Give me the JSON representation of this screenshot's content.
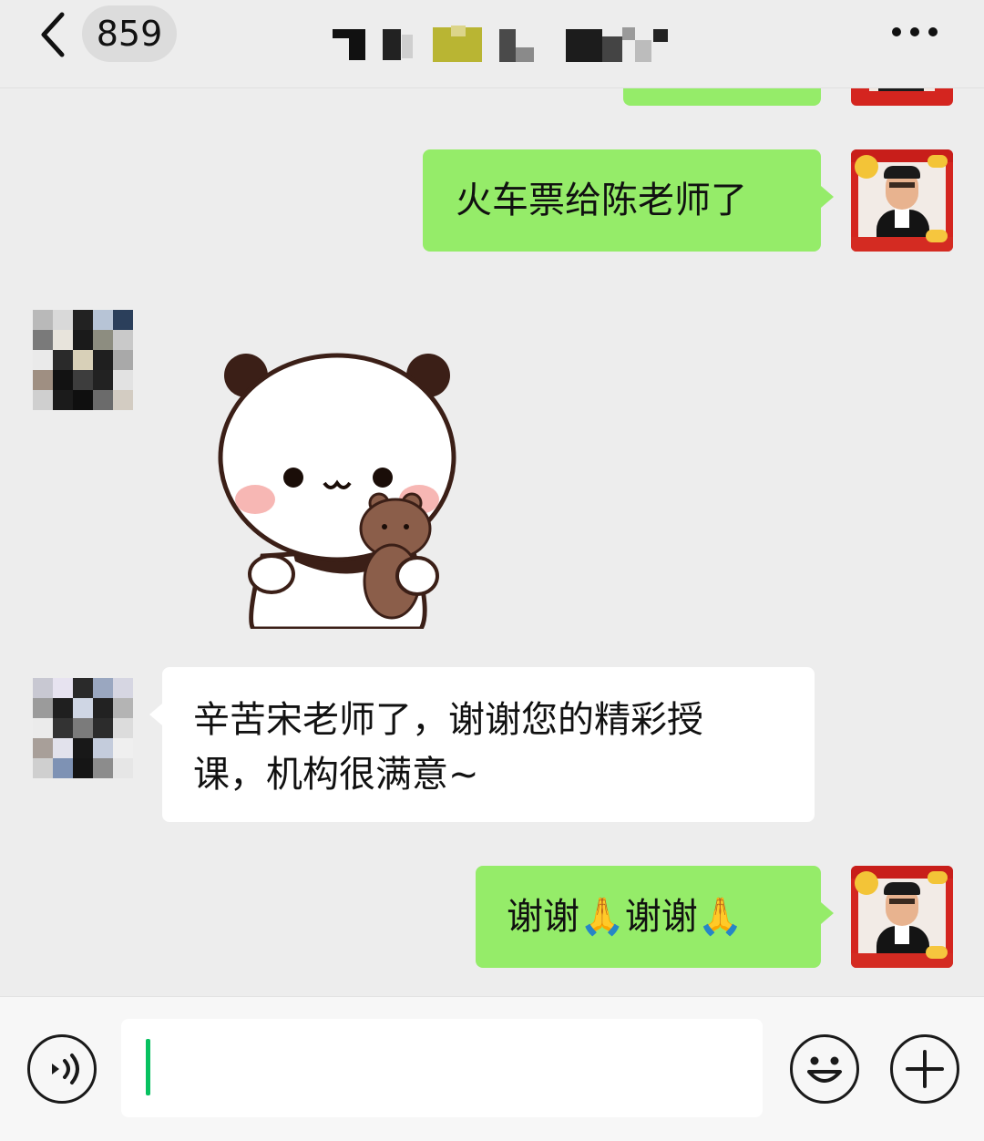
{
  "header": {
    "back_icon": "chevron-left-icon",
    "unread_count": "859",
    "more_icon": "more-dots-icon"
  },
  "messages": [
    {
      "direction": "outgoing",
      "type": "text",
      "text": "火车票给陈老师了"
    },
    {
      "direction": "incoming",
      "type": "sticker",
      "sticker": "panda-holding-teddy-bear"
    },
    {
      "direction": "incoming",
      "type": "text",
      "line1": "辛苦宋老师了，谢谢您的精彩授",
      "line2": "课，机构很满意~"
    },
    {
      "direction": "outgoing",
      "type": "text",
      "text": "谢谢🙏谢谢🙏"
    }
  ],
  "input_bar": {
    "voice_icon": "voice-icon",
    "emoji_icon": "emoji-icon",
    "plus_icon": "plus-icon",
    "input_value": ""
  },
  "colors": {
    "outgoing_bubble": "#95ec69",
    "incoming_bubble": "#ffffff",
    "background": "#ededed",
    "caret": "#07c160"
  }
}
